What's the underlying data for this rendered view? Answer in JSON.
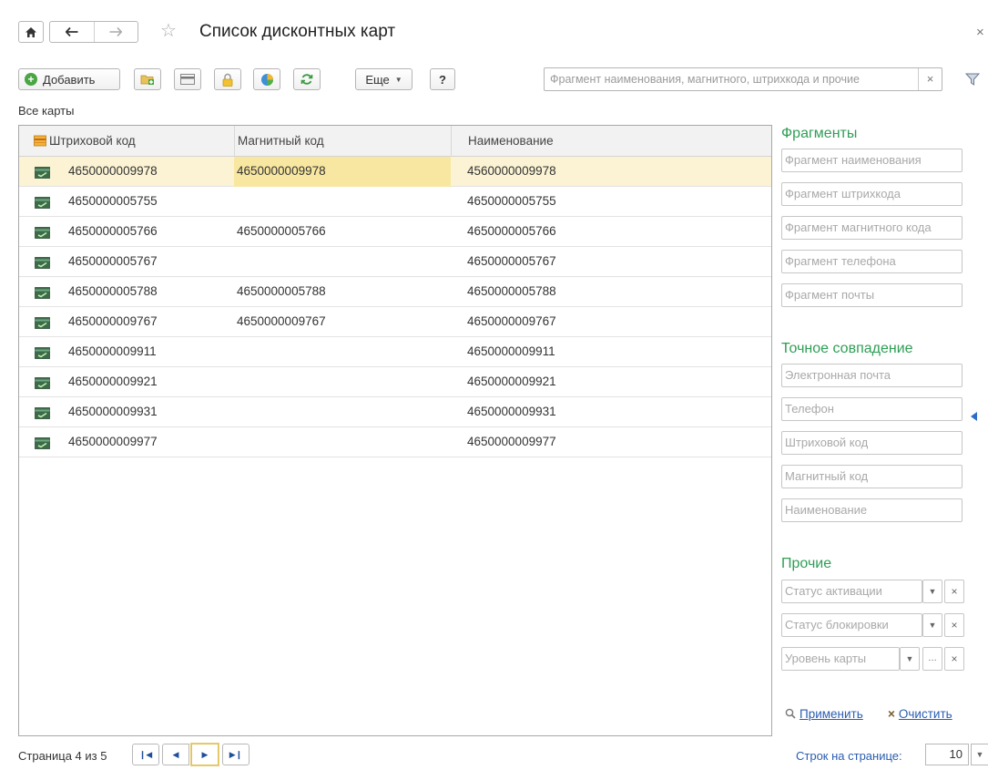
{
  "window": {
    "title": "Список дисконтных карт",
    "close_glyph": "×"
  },
  "toolbar": {
    "add_label": "Добавить",
    "more_label": "Еще",
    "help_label": "?",
    "search_placeholder": "Фрагмент наименования, магнитного, штрихкода и прочие",
    "search_clear": "×"
  },
  "list_caption": "Все карты",
  "table": {
    "columns": [
      "Штриховой код",
      "Магнитный код",
      "Наименование"
    ],
    "rows": [
      {
        "barcode": "4650000009978",
        "magnetic": "4650000009978",
        "name": "4560000009978",
        "selected": true
      },
      {
        "barcode": "4650000005755",
        "magnetic": "",
        "name": "4650000005755"
      },
      {
        "barcode": "4650000005766",
        "magnetic": "4650000005766",
        "name": "4650000005766"
      },
      {
        "barcode": "4650000005767",
        "magnetic": "",
        "name": "4650000005767"
      },
      {
        "barcode": "4650000005788",
        "magnetic": "4650000005788",
        "name": "4650000005788"
      },
      {
        "barcode": "4650000009767",
        "magnetic": "4650000009767",
        "name": "4650000009767"
      },
      {
        "barcode": "4650000009911",
        "magnetic": "",
        "name": "4650000009911"
      },
      {
        "barcode": "4650000009921",
        "magnetic": "",
        "name": "4650000009921"
      },
      {
        "barcode": "4650000009931",
        "magnetic": "",
        "name": "4650000009931"
      },
      {
        "barcode": "4650000009977",
        "magnetic": "",
        "name": "4650000009977"
      }
    ]
  },
  "filters": {
    "fragments": {
      "title": "Фрагменты",
      "fields": [
        "Фрагмент наименования",
        "Фрагмент штрихкода",
        "Фрагмент магнитного кода",
        "Фрагмент телефона",
        "Фрагмент почты"
      ]
    },
    "exact": {
      "title": "Точное совпадение",
      "fields": [
        "Электронная почта",
        "Телефон",
        "Штриховой код",
        "Магнитный код",
        "Наименование"
      ]
    },
    "other": {
      "title": "Прочие",
      "fields": [
        "Статус активации",
        "Статус блокировки",
        "Уровень карты"
      ]
    },
    "apply_label": "Применить",
    "clear_label": "Очистить"
  },
  "pagination": {
    "info": "Страница 4 из 5",
    "rows_per_page_label": "Строк на странице:",
    "rows_per_page_value": "10"
  },
  "colors": {
    "accent_green": "#2e9e55",
    "link_blue": "#2a5db0",
    "selected_row": "#fbf3d3"
  }
}
